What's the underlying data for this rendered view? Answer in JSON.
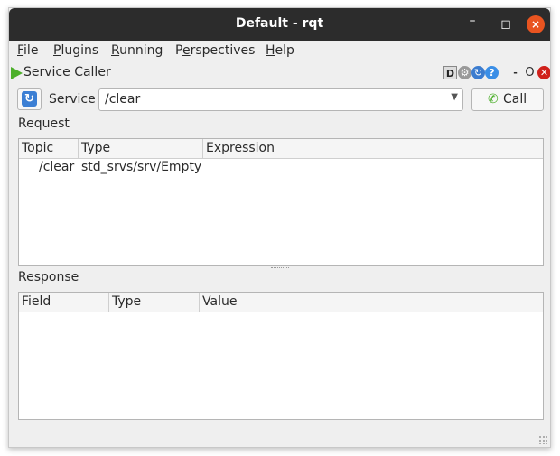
{
  "window": {
    "title": "Default - rqt",
    "controls": {
      "minimize": "–",
      "maximize": "◻",
      "close": "×"
    }
  },
  "menubar": [
    {
      "mnemonic": "F",
      "rest": "ile"
    },
    {
      "mnemonic": "P",
      "rest": "lugins"
    },
    {
      "mnemonic": "R",
      "rest": "unning"
    },
    {
      "pre": "P",
      "mnemonic": "e",
      "rest": "rspectives"
    },
    {
      "mnemonic": "H",
      "rest": "elp"
    }
  ],
  "plugin": {
    "title": "Service Caller",
    "icons": [
      "play-icon",
      "dock-icon",
      "settings-icon",
      "reload-icon",
      "help-icon",
      "minimize-icon",
      "float-icon",
      "close-icon"
    ],
    "buttons": {
      "d": "D",
      "gear": "⚙",
      "reload": "↻",
      "help": "?",
      "minus": "-",
      "o": "O",
      "x": "✕"
    }
  },
  "service": {
    "label": "Service",
    "selected": "/clear",
    "call_label": "Call"
  },
  "request": {
    "label": "Request",
    "columns": [
      "Topic",
      "Type",
      "Expression"
    ],
    "rows": [
      {
        "topic": "/clear",
        "type": "std_srvs/srv/Empty",
        "expression": ""
      }
    ]
  },
  "response": {
    "label": "Response",
    "columns": [
      "Field",
      "Type",
      "Value"
    ],
    "rows": []
  },
  "colors": {
    "titlebar": "#2c2c2c",
    "close_button": "#e95420",
    "play_green": "#4caf2a",
    "window_bg": "#efefef"
  }
}
